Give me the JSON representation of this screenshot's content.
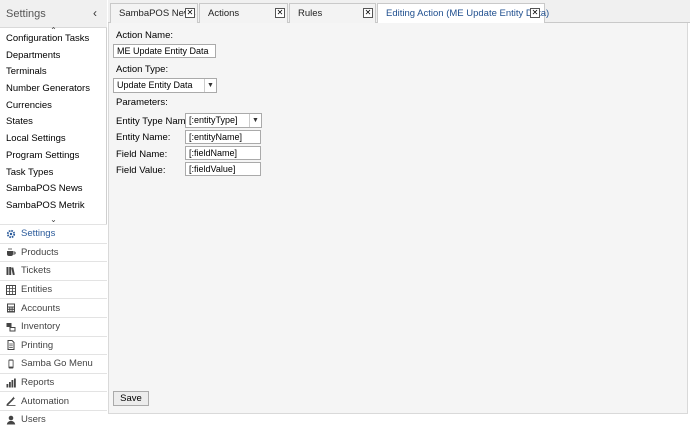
{
  "sidebar": {
    "title": "Settings",
    "collapse_glyph": "‹",
    "scroll_up": "⌃",
    "scroll_down": "⌄",
    "items": [
      {
        "label": "Configuration Tasks"
      },
      {
        "label": "Departments"
      },
      {
        "label": "Terminals"
      },
      {
        "label": "Number Generators"
      },
      {
        "label": "Currencies"
      },
      {
        "label": "States"
      },
      {
        "label": "Local Settings"
      },
      {
        "label": "Program Settings"
      },
      {
        "label": "Task Types"
      },
      {
        "label": "SambaPOS News"
      },
      {
        "label": "SambaPOS Metrik"
      }
    ],
    "nav": [
      {
        "label": "Settings",
        "icon": "gear-icon",
        "active": true
      },
      {
        "label": "Products",
        "icon": "coffee-cup-icon"
      },
      {
        "label": "Tickets",
        "icon": "books-icon"
      },
      {
        "label": "Entities",
        "icon": "grid-icon"
      },
      {
        "label": "Accounts",
        "icon": "calculator-icon"
      },
      {
        "label": "Inventory",
        "icon": "boxes-icon"
      },
      {
        "label": "Printing",
        "icon": "document-icon"
      },
      {
        "label": "Samba Go Menu",
        "icon": "phone-icon"
      },
      {
        "label": "Reports",
        "icon": "bar-chart-icon"
      },
      {
        "label": "Automation",
        "icon": "magic-wand-icon"
      },
      {
        "label": "Users",
        "icon": "user-icon"
      }
    ]
  },
  "tabs": [
    {
      "label": "SambaPOS News",
      "close": "✕",
      "active": false
    },
    {
      "label": "Actions",
      "close": "✕",
      "active": false
    },
    {
      "label": "Rules",
      "close": "✕",
      "active": false
    },
    {
      "label": "Editing Action (ME Update Entity Data)",
      "close": "✕",
      "active": true
    }
  ],
  "form": {
    "action_name_label": "Action Name:",
    "action_name_value": "ME Update Entity Data",
    "action_type_label": "Action Type:",
    "action_type_value": "Update Entity Data",
    "parameters_label": "Parameters:",
    "params": [
      {
        "label": "Entity Type Name:",
        "value": "[:entityType]",
        "kind": "select"
      },
      {
        "label": "Entity Name:",
        "value": "[:entityName]",
        "kind": "input"
      },
      {
        "label": "Field Name:",
        "value": "[:fieldName]",
        "kind": "input"
      },
      {
        "label": "Field Value:",
        "value": "[:fieldValue]",
        "kind": "input"
      }
    ],
    "save_label": "Save"
  },
  "colors": {
    "active_nav": "#2a5a9a",
    "active_tab_text": "#1f4f8f",
    "content_bg": "#f5f5f5"
  }
}
